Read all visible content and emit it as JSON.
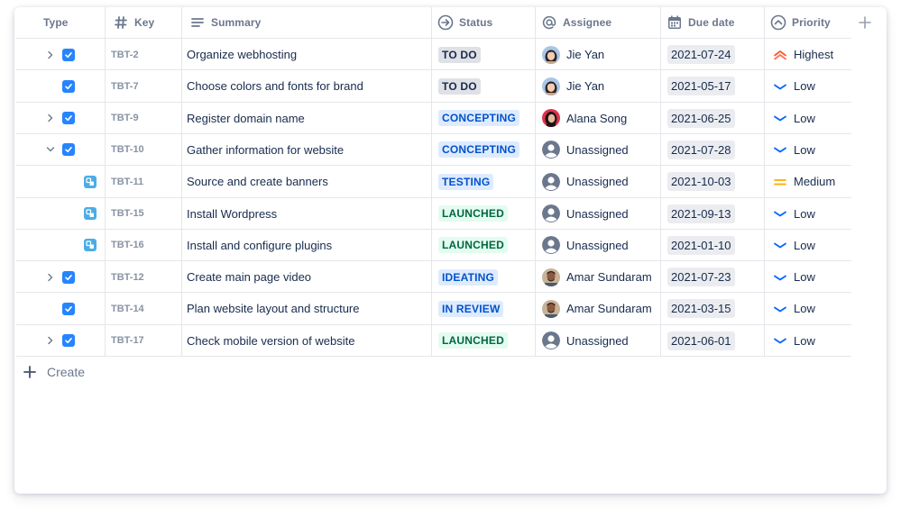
{
  "columns": {
    "type": "Type",
    "key": "Key",
    "summary": "Summary",
    "status": "Status",
    "assignee": "Assignee",
    "due_date": "Due date",
    "priority": "Priority"
  },
  "rows": [
    {
      "key": "TBT-2",
      "summary": "Organize webhosting",
      "status": "TO DO",
      "status_color": "grey",
      "assignee": "Jie Yan",
      "avatar": "jie",
      "due": "2021-07-24",
      "priority": "Highest",
      "expand": "collapsed",
      "issue_type": "task"
    },
    {
      "key": "TBT-7",
      "summary": "Choose colors and fonts for brand",
      "status": "TO DO",
      "status_color": "grey",
      "assignee": "Jie Yan",
      "avatar": "jie",
      "due": "2021-05-17",
      "priority": "Low",
      "expand": "none",
      "issue_type": "task"
    },
    {
      "key": "TBT-9",
      "summary": "Register domain name",
      "status": "CONCEPTING",
      "status_color": "blue",
      "assignee": "Alana Song",
      "avatar": "alana",
      "due": "2021-06-25",
      "priority": "Low",
      "expand": "collapsed",
      "issue_type": "task"
    },
    {
      "key": "TBT-10",
      "summary": "Gather information for website",
      "status": "CONCEPTING",
      "status_color": "blue",
      "assignee": "Unassigned",
      "avatar": "none",
      "due": "2021-07-28",
      "priority": "Low",
      "expand": "expanded",
      "issue_type": "task"
    },
    {
      "key": "TBT-11",
      "summary": "Source and create banners",
      "status": "TESTING",
      "status_color": "blue",
      "assignee": "Unassigned",
      "avatar": "none",
      "due": "2021-10-03",
      "priority": "Medium",
      "expand": "none",
      "issue_type": "subtask"
    },
    {
      "key": "TBT-15",
      "summary": "Install Wordpress",
      "status": "LAUNCHED",
      "status_color": "green",
      "assignee": "Unassigned",
      "avatar": "none",
      "due": "2021-09-13",
      "priority": "Low",
      "expand": "none",
      "issue_type": "subtask"
    },
    {
      "key": "TBT-16",
      "summary": "Install and configure plugins",
      "status": "LAUNCHED",
      "status_color": "green",
      "assignee": "Unassigned",
      "avatar": "none",
      "due": "2021-01-10",
      "priority": "Low",
      "expand": "none",
      "issue_type": "subtask"
    },
    {
      "key": "TBT-12",
      "summary": "Create main page video",
      "status": "IDEATING",
      "status_color": "blue",
      "assignee": "Amar Sundaram",
      "avatar": "amar",
      "due": "2021-07-23",
      "priority": "Low",
      "expand": "collapsed",
      "issue_type": "task"
    },
    {
      "key": "TBT-14",
      "summary": "Plan website layout and structure",
      "status": "IN REVIEW",
      "status_color": "blue",
      "assignee": "Amar Sundaram",
      "avatar": "amar",
      "due": "2021-03-15",
      "priority": "Low",
      "expand": "none",
      "issue_type": "task"
    },
    {
      "key": "TBT-17",
      "summary": "Check mobile version of website",
      "status": "LAUNCHED",
      "status_color": "green",
      "assignee": "Unassigned",
      "avatar": "none",
      "due": "2021-06-01",
      "priority": "Low",
      "expand": "collapsed",
      "issue_type": "task"
    }
  ],
  "create_label": "Create",
  "colors": {
    "accent": "#2684ff",
    "subtask": "#4bade8",
    "priority_highest": "#ff5630",
    "priority_medium": "#ffab00",
    "priority_low": "#0065ff"
  },
  "icons": {
    "key_column": "hash-icon",
    "summary_column": "lines-icon",
    "status_column": "arrow-circle-icon",
    "assignee_column": "at-icon",
    "due_date_column": "calendar-icon",
    "priority_column": "chevron-up-circle-icon",
    "add_column": "plus-icon",
    "create": "plus-icon"
  }
}
